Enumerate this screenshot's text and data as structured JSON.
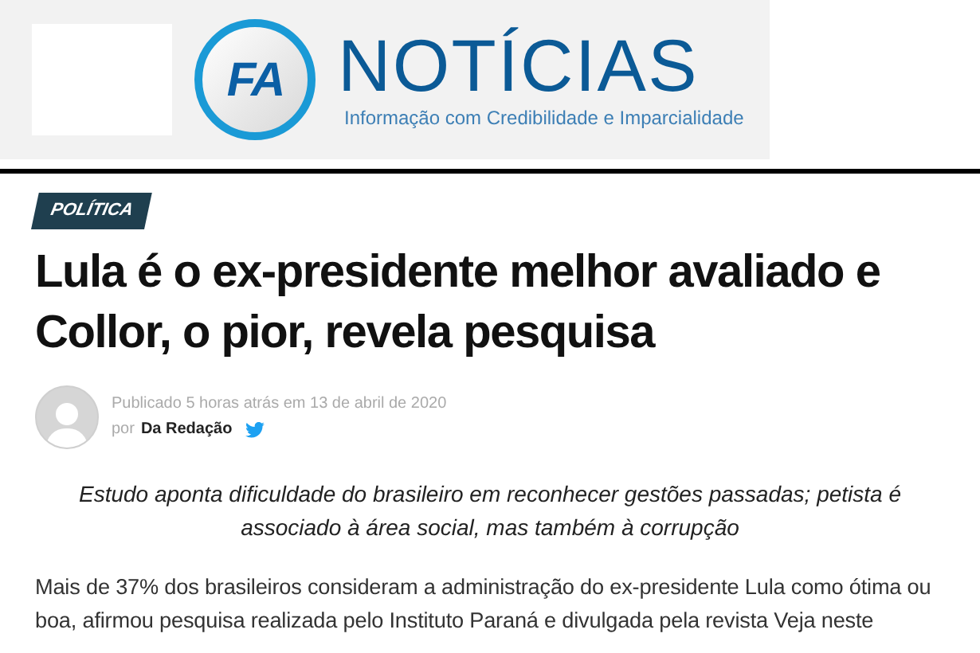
{
  "logo": {
    "mark": "FA",
    "name": "NOTÍCIAS",
    "tagline": "Informação com Credibilidade e Imparcialidade"
  },
  "category": "POLÍTICA",
  "headline": "Lula é o ex-presidente melhor avaliado e Collor, o pior, revela pesquisa",
  "byline": {
    "published": "Publicado 5 horas atrás em 13 de abril de 2020",
    "prefix": "por",
    "author": "Da Redação"
  },
  "subtitle": "Estudo aponta dificuldade do brasileiro em reconhecer gestões passadas; petista é associado à área social, mas também à corrupção",
  "body": "Mais de 37% dos brasileiros consideram a administração do ex-presidente Lula como ótima ou boa, afirmou pesquisa realizada pelo Instituto Paraná e divulgada pela revista Veja neste"
}
